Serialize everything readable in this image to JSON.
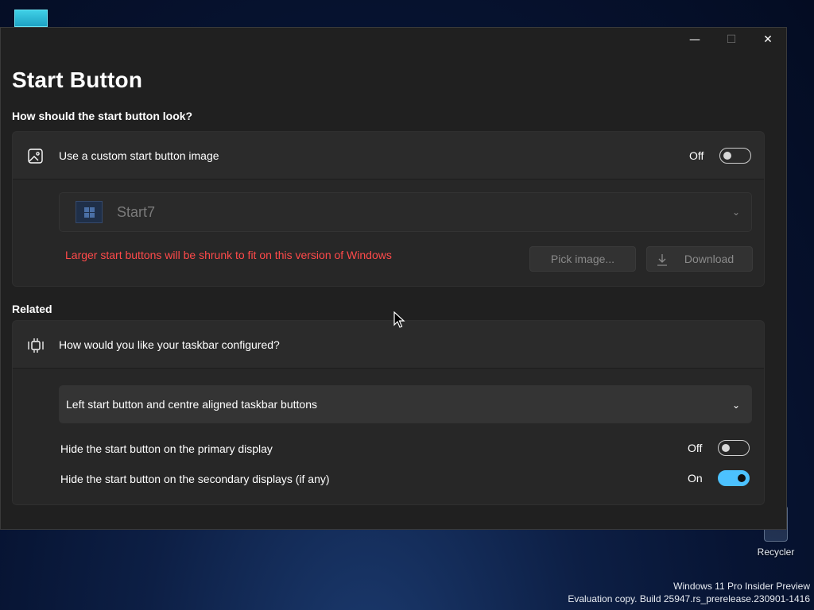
{
  "window": {
    "title": "Start Button",
    "controls": {
      "minimize": "—",
      "maximize": "☐",
      "close": "✕"
    }
  },
  "appearance": {
    "section_label": "How should the start button look?",
    "custom_image": {
      "label": "Use a custom start button image",
      "icon": "image-icon",
      "toggle_state_text": "Off",
      "toggle_on": false
    },
    "style_combo": {
      "value": "Start7",
      "disabled": true
    },
    "warning": "Larger start buttons will be shrunk to fit on this version of Windows",
    "pick_button": "Pick image...",
    "download_button": "Download"
  },
  "related": {
    "section_label": "Related",
    "taskbar": {
      "label": "How would you like your taskbar configured?",
      "icon": "taskbar-config-icon",
      "combo_value": "Left start button and centre aligned taskbar buttons"
    },
    "hide_primary": {
      "label": "Hide the start button on the primary display",
      "state_text": "Off",
      "on": false
    },
    "hide_secondary": {
      "label": "Hide the start button on the secondary displays (if any)",
      "state_text": "On",
      "on": true
    }
  },
  "desktop": {
    "recycle_label": "Recycler",
    "watermark_line1": "Windows 11 Pro Insider Preview",
    "watermark_line2": "Evaluation copy. Build 25947.rs_prerelease.230901-1416"
  },
  "colors": {
    "accent": "#4cc2ff",
    "warning": "#ff4a4a",
    "window_bg": "#202020",
    "card_bg": "#2b2b2b"
  }
}
